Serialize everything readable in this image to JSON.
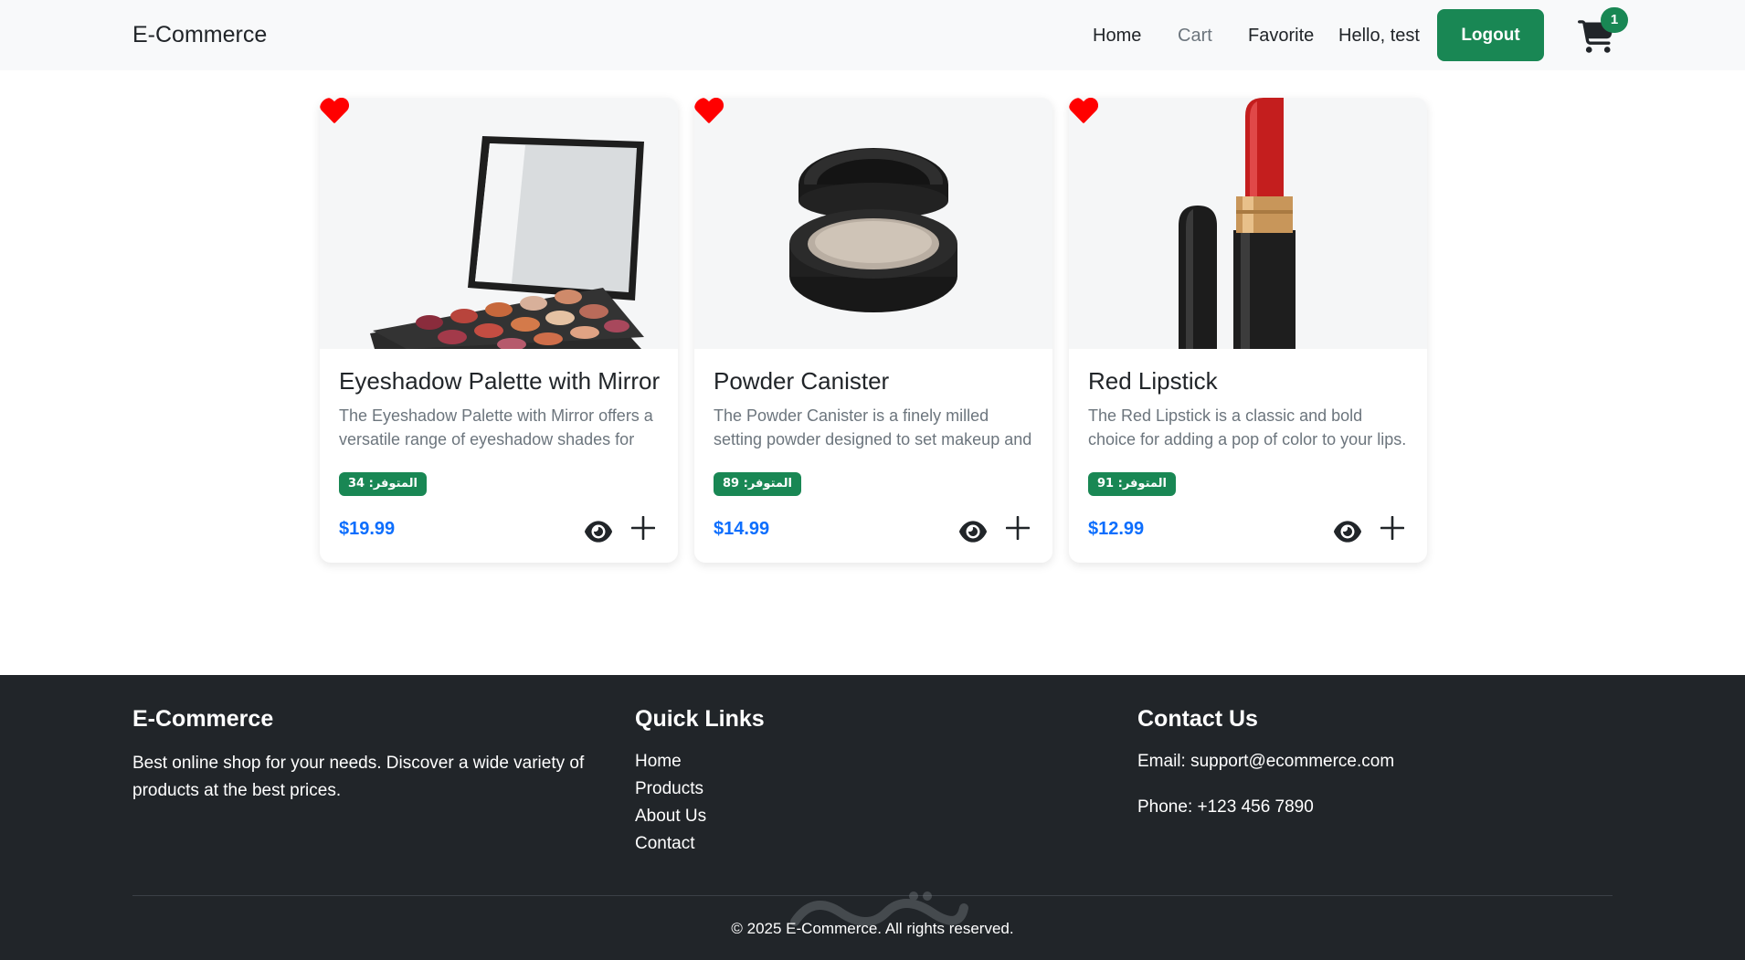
{
  "navbar": {
    "brand": "E-Commerce",
    "links": [
      "Home",
      "Cart",
      "Favorite"
    ],
    "greeting": "Hello, test",
    "logout_label": "Logout",
    "cart_count": "1",
    "cart_icon": "shopping-cart-icon"
  },
  "products": [
    {
      "title": "Eyeshadow Palette with Mirror",
      "description": "The Eyeshadow Palette with Mirror offers a versatile range of eyeshadow shades for",
      "stock": "المتوفر: 34",
      "price": "$19.99",
      "image": "eyeshadow-palette-image"
    },
    {
      "title": "Powder Canister",
      "description": "The Powder Canister is a finely milled setting powder designed to set makeup and control",
      "stock": "المتوفر: 89",
      "price": "$14.99",
      "image": "powder-canister-image"
    },
    {
      "title": "Red Lipstick",
      "description": "The Red Lipstick is a classic and bold choice for adding a pop of color to your lips. With a",
      "stock": "المتوفر: 91",
      "price": "$12.99",
      "image": "red-lipstick-image"
    }
  ],
  "footer": {
    "brand_heading": "E-Commerce",
    "brand_text": "Best online shop for your needs. Discover a wide variety of products at the best prices.",
    "links_heading": "Quick Links",
    "links": [
      "Home",
      "Products",
      "About Us",
      "Contact"
    ],
    "contact_heading": "Contact Us",
    "email": "Email: support@ecommerce.com",
    "phone": "Phone: +123 456 7890",
    "copyright": "© 2025 E-Commerce. All rights reserved."
  },
  "colors": {
    "accent_green": "#198754",
    "price_blue": "#0d6efd",
    "favorite_red": "#ff0000",
    "footer_bg": "#212529",
    "navbar_bg": "#f8f9fa"
  },
  "icons": [
    "heart-icon",
    "eye-icon",
    "plus-icon",
    "shopping-cart-icon"
  ]
}
